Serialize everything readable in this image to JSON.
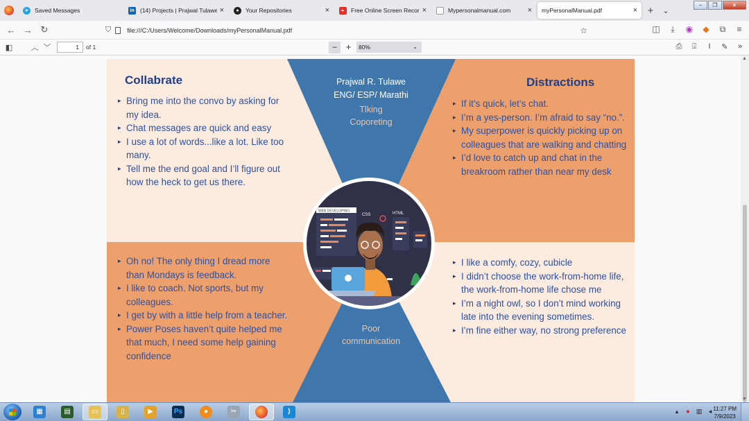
{
  "browser": {
    "tabs": [
      {
        "label": "Saved Messages",
        "icon": "telegram-icon",
        "active": false
      },
      {
        "label": "(14) Projects | Prajwal Tulawe | L",
        "icon": "linkedin-icon",
        "active": false
      },
      {
        "label": "Your Repositories",
        "icon": "github-icon",
        "active": false
      },
      {
        "label": "Free Online Screen Recorder & ",
        "icon": "recorder-icon",
        "active": false
      },
      {
        "label": "Mypersonalmanual.com",
        "icon": "page-icon",
        "active": false
      },
      {
        "label": "myPersonalManual.pdf",
        "icon": "pdf-icon",
        "active": true
      }
    ],
    "url": "file:///C:/Users/Welcome/Downloads/myPersonalManual.pdf"
  },
  "pdf_toolbar": {
    "page_number": "1",
    "page_count": "of 1",
    "zoom": "80%"
  },
  "manual": {
    "collaborate": {
      "heading": "Collabrate",
      "items": [
        "Bring me into the convo by asking for my idea.",
        "Chat messages are quick and easy",
        "I use a lot of words...like a lot. Like too many.",
        "Tell me the end goal and I’ll figure out how the heck to get us there."
      ]
    },
    "distractions": {
      "heading": "Distractions",
      "items": [
        "If it’s quick, let’s chat.",
        "I’m a yes-person. I’m afraid to say “no.”.",
        "My superpower is quickly picking up on colleagues that are walking and chatting",
        "I’d love to catch up and chat in the breakroom rather than near my desk"
      ]
    },
    "feedback": {
      "items": [
        "Oh no! The only thing I dread more than Mondays is feedback.",
        "I like to coach. Not sports, but my colleagues.",
        "I get by with a little help from a teacher.",
        "Power Poses haven’t quite helped me that much, I need some help gaining confidence"
      ]
    },
    "environment": {
      "items": [
        "I like a comfy, cozy, cubicle",
        "I didn’t choose the work-from-home life, the work-from-home life chose me",
        "I’m a night owl, so I don’t mind working late into the evening sometimes.",
        "I’m fine either way, no strong preference"
      ]
    },
    "center": {
      "name": "Prajwal R. Tulawe",
      "languages": "ENG/ ESP/ Marathi",
      "skill_1": "Tlking",
      "skill_2": "Coporeting",
      "weakness_1": "Poor",
      "weakness_2": "communication"
    },
    "illustration": {
      "label_1": "WEB DEVELOPING",
      "label_2": "CSS",
      "label_3": "HTML"
    }
  },
  "taskbar": {
    "time": "11:27 PM",
    "date": "7/9/2023"
  }
}
